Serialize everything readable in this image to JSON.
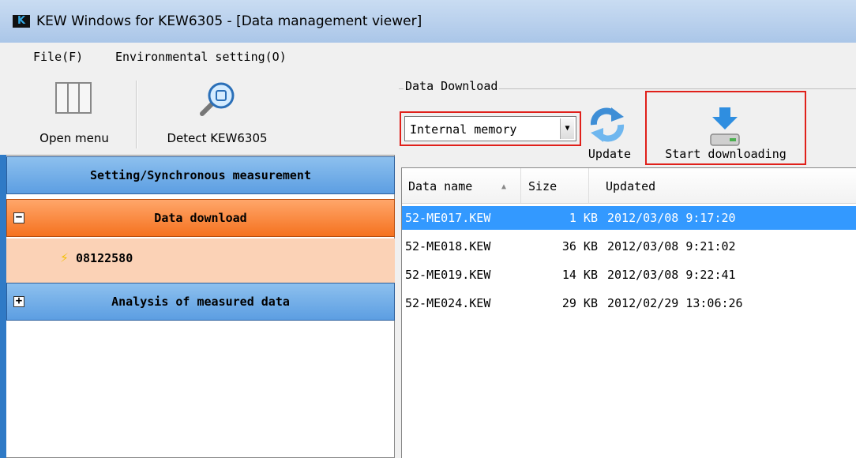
{
  "window": {
    "title": "KEW Windows for KEW6305 - [Data management viewer]",
    "logo": "K"
  },
  "menu": {
    "items": [
      "File(F)",
      "Environmental setting(O)"
    ]
  },
  "toolbar": {
    "open_menu": "Open menu",
    "detect": "Detect KEW6305"
  },
  "nav": {
    "setting_group": "Setting/Synchronous measurement",
    "download_group": "Data download",
    "download_expander": "−",
    "device": "08122580",
    "analysis_group": "Analysis of measured data",
    "analysis_expander": "+"
  },
  "download": {
    "caption": "Data Download",
    "source_value": "Internal memory",
    "update_label": "Update",
    "start_label": "Start downloading"
  },
  "filelist": {
    "columns": [
      "Data name",
      "Size",
      "Updated"
    ],
    "sort_indicator": "▲",
    "rows": [
      {
        "name": "52-ME017.KEW",
        "size": "1 KB",
        "updated": "2012/03/08 9:17:20",
        "selected": true
      },
      {
        "name": "52-ME018.KEW",
        "size": "36 KB",
        "updated": "2012/03/08 9:21:02",
        "selected": false
      },
      {
        "name": "52-ME019.KEW",
        "size": "14 KB",
        "updated": "2012/03/08 9:22:41",
        "selected": false
      },
      {
        "name": "52-ME024.KEW",
        "size": "29 KB",
        "updated": "2012/02/29 13:06:26",
        "selected": false
      }
    ]
  },
  "colors": {
    "selection": "#3399ff",
    "highlight_box": "#e0201a",
    "blue_group": "#5c9ee2",
    "orange_group": "#f5721f",
    "device_bg": "#fbd2b6"
  }
}
